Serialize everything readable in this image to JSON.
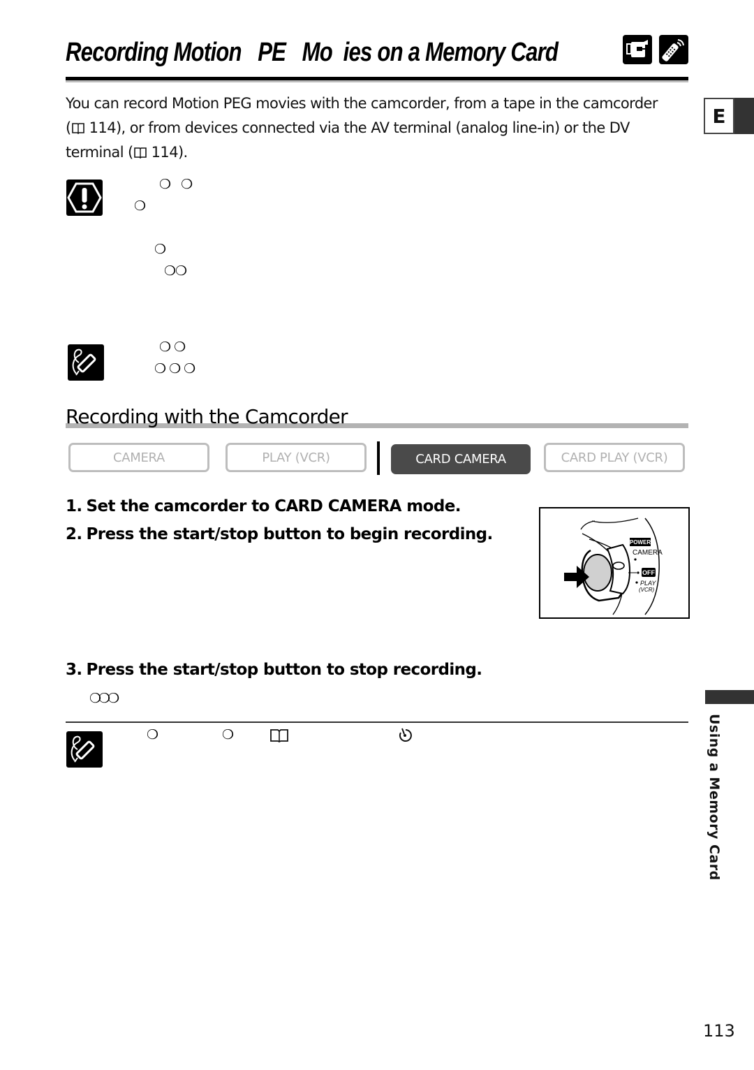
{
  "page": {
    "title": "Recording Motion   PE   Mo  ies on a Memory Card",
    "title_icons": [
      "camcorder-icon",
      "remote-control-icon"
    ],
    "language_tab": "E",
    "chapter_label": "Using a Memory Card",
    "page_number": "113"
  },
  "intro": {
    "line1": "You can record Motion  PEG movies with the camcorder, from a tape in the camcorder",
    "line2_open": "(",
    "line2_ref": "114",
    "line2_rest": "), or from devices connected via the AV terminal (analog line-in) or the DV",
    "line3_pre": "terminal (",
    "line3_ref": "114",
    "line3_post": ")."
  },
  "caution_block": {
    "icon": "caution-icon",
    "glyph_rows": [
      "❍   ❍",
      "❍",
      "❍",
      "❍❍"
    ]
  },
  "note_block_1": {
    "icon": "note-pencil-icon",
    "glyph_rows": [
      "❍ ❍",
      "❍ ❍ ❍"
    ]
  },
  "section": {
    "heading": "Recording with the Camcorder",
    "modes": [
      {
        "label": "CAMERA",
        "active": false
      },
      {
        "label": "PLAY (VCR)",
        "active": false
      },
      {
        "label": "CARD CAMERA",
        "active": true
      },
      {
        "label": "CARD PLAY (VCR)",
        "active": false
      }
    ],
    "steps": [
      {
        "num": "1.",
        "text": "Set the camcorder to CARD CAMERA mode."
      },
      {
        "num": "2.",
        "text": "Press the start/stop button to begin recording."
      },
      {
        "num": "3.",
        "text": "Press the start/stop button to stop recording."
      }
    ],
    "step3_glyphs": "❍❍❍",
    "illustration": {
      "labels": {
        "power": "POWER",
        "camera": "CAMERA",
        "off": "OFF",
        "play": "PLAY",
        "vcr": "(VCR)"
      }
    }
  },
  "note_block_2": {
    "icon": "note-pencil-icon",
    "glyphs": [
      "❍",
      "❍",
      "book-icon",
      "self-timer-icon"
    ]
  }
}
